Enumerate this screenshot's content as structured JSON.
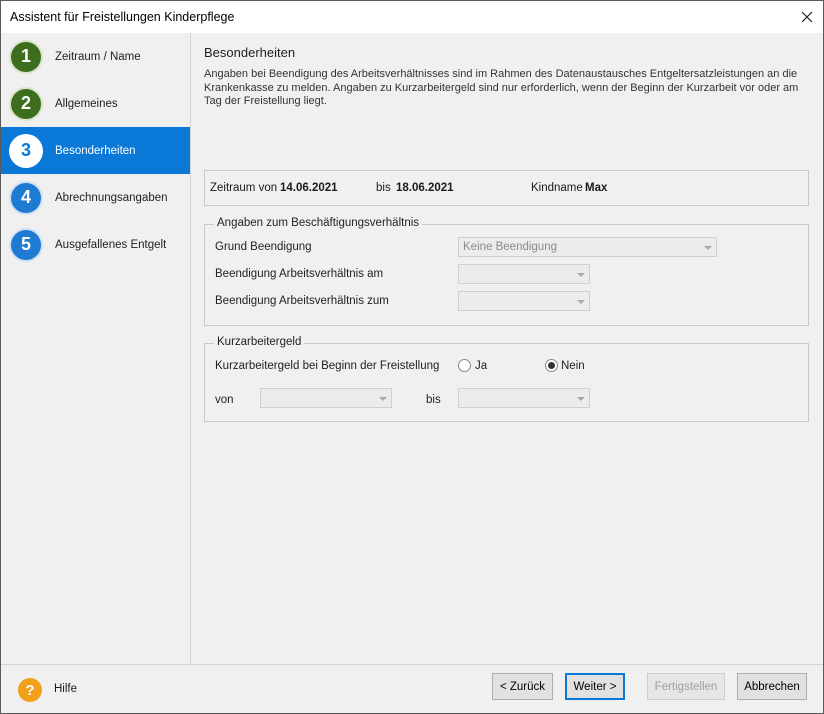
{
  "window": {
    "title": "Assistent für Freistellungen Kinderpflege"
  },
  "sidebar": {
    "steps": [
      {
        "number": "1",
        "label": "Zeitraum / Name",
        "state": "done"
      },
      {
        "number": "2",
        "label": "Allgemeines",
        "state": "done"
      },
      {
        "number": "3",
        "label": "Besonderheiten",
        "state": "active"
      },
      {
        "number": "4",
        "label": "Abrechnungsangaben",
        "state": "todo"
      },
      {
        "number": "5",
        "label": "Ausgefallenes Entgelt",
        "state": "todo"
      }
    ]
  },
  "main": {
    "heading": "Besonderheiten",
    "description": "Angaben bei Beendigung des Arbeitsverhältnisses sind im Rahmen des Datenaustausches Entgeltersatzleistungen an die Krankenkasse zu melden. Angaben zu Kurzarbeitergeld sind nur erforderlich, wenn der Beginn der Kurzarbeit vor oder am Tag der Freistellung liegt.",
    "info": {
      "zeitraum_label": "Zeitraum von",
      "von_value": "14.06.2021",
      "bis_label": "bis",
      "bis_value": "18.06.2021",
      "kindname_label": "Kindname",
      "kindname_value": "Max"
    },
    "beschaeftigung": {
      "legend": "Angaben zum Beschäftigungsverhältnis",
      "grund_label": "Grund Beendigung",
      "grund_value": "Keine Beendigung",
      "beendigung_am_label": "Beendigung Arbeitsverhältnis am",
      "beendigung_am_value": "",
      "beendigung_zum_label": "Beendigung Arbeitsverhältnis zum",
      "beendigung_zum_value": ""
    },
    "kurzarbeit": {
      "legend": "Kurzarbeitergeld",
      "question_label": "Kurzarbeitergeld bei Beginn der Freistellung",
      "option_ja": "Ja",
      "option_nein": "Nein",
      "selected": "Nein",
      "von_label": "von",
      "von_value": "",
      "bis_label": "bis",
      "bis_value": ""
    }
  },
  "footer": {
    "help_label": "Hilfe",
    "back_label": "< Zurück",
    "next_label": "Weiter >",
    "finish_label": "Fertigstellen",
    "cancel_label": "Abbrechen"
  },
  "colors": {
    "active_step": "#0a78d7",
    "done_step": "#3d6e1e",
    "todo_step": "#1f7ad2",
    "help_icon": "#f0a019"
  }
}
